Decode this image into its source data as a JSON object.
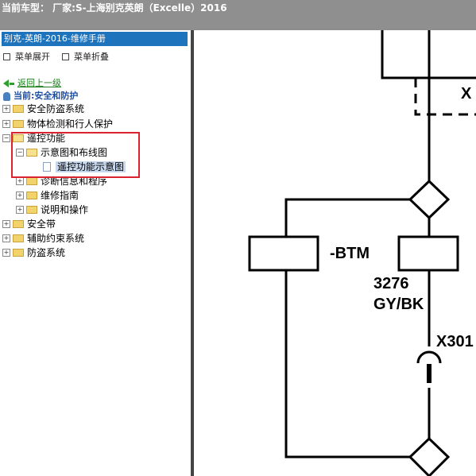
{
  "header": {
    "title": "当前车型： 厂家:S-上海别克英朗（Excelle）2016"
  },
  "sidebar": {
    "heading": "别克-英朗-2016-维修手册",
    "expand_label": "菜单展开",
    "collapse_label": "菜单折叠",
    "back_label": "返回上一级",
    "current_label": "当前:安全和防护",
    "tree": [
      {
        "label": "安全防盗系统"
      },
      {
        "label": "物体检测和行人保护"
      },
      {
        "label": "遥控功能"
      },
      {
        "label": "示意图和布线图"
      },
      {
        "label": "遥控功能示意图"
      },
      {
        "label": "诊断信息和程序"
      },
      {
        "label": "维修指南"
      },
      {
        "label": "说明和操作"
      },
      {
        "label": "安全带"
      },
      {
        "label": "辅助约束系统"
      },
      {
        "label": "防盗系统"
      }
    ]
  },
  "diagram": {
    "labels": {
      "x_top": "X",
      "btm": "-BTM",
      "circuit_number": "3276",
      "wire_color": "GY/BK",
      "connector": "X301"
    }
  }
}
